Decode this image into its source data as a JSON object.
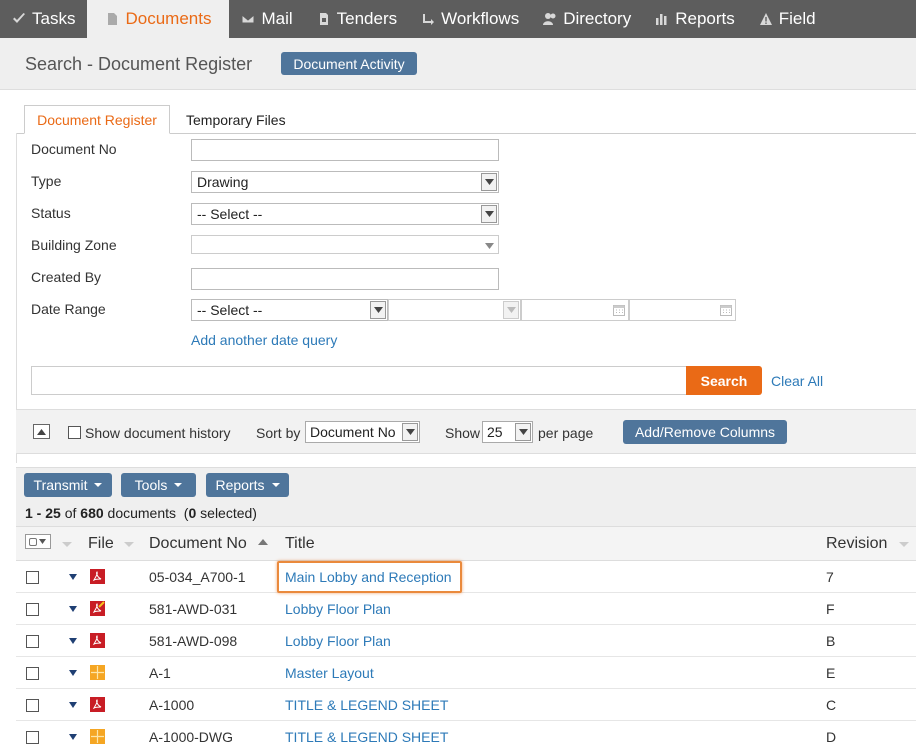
{
  "nav": [
    {
      "label": "Tasks",
      "icon": "check-icon",
      "active": false
    },
    {
      "label": "Documents",
      "icon": "document-icon",
      "active": true
    },
    {
      "label": "Mail",
      "icon": "mail-icon",
      "active": false
    },
    {
      "label": "Tenders",
      "icon": "tender-icon",
      "active": false
    },
    {
      "label": "Workflows",
      "icon": "workflow-icon",
      "active": false
    },
    {
      "label": "Directory",
      "icon": "people-icon",
      "active": false
    },
    {
      "label": "Reports",
      "icon": "bar-chart-icon",
      "active": false
    },
    {
      "label": "Field",
      "icon": "warning-icon",
      "active": false
    }
  ],
  "header": {
    "title": "Search - Document Register",
    "activity_button": "Document Activity"
  },
  "tabs": {
    "register": "Document Register",
    "temporary": "Temporary Files"
  },
  "form": {
    "document_no_label": "Document No",
    "document_no_value": "",
    "type_label": "Type",
    "type_value": "Drawing",
    "status_label": "Status",
    "status_value": "-- Select --",
    "zone_label": "Building Zone",
    "zone_value": "",
    "created_by_label": "Created By",
    "created_by_value": "",
    "date_range_label": "Date Range",
    "date_range_value": "-- Select --",
    "add_date_query": "Add another date query",
    "search_button": "Search",
    "clear_all": "Clear All"
  },
  "options": {
    "show_history": "Show document history",
    "sort_by_label": "Sort by",
    "sort_by_value": "Document No",
    "show_label": "Show",
    "show_value": "25",
    "per_page": "per page",
    "columns_button": "Add/Remove Columns"
  },
  "toolbar": {
    "transmit": "Transmit",
    "tools": "Tools",
    "reports": "Reports"
  },
  "results": {
    "range": "1 - 25",
    "of": "of",
    "total": "680",
    "documents": "documents",
    "selected_open": "(",
    "selected_count": "0",
    "selected_close": "selected)"
  },
  "columns": {
    "file": "File",
    "document_no": "Document No",
    "title": "Title",
    "revision": "Revision"
  },
  "rows": [
    {
      "file_icon": "pdf-icon",
      "document_no": "05-034_A700-1",
      "title": "Main Lobby and Reception",
      "revision": "7"
    },
    {
      "file_icon": "pdf-markup-icon",
      "document_no": "581-AWD-031",
      "title": "Lobby Floor Plan",
      "revision": "F"
    },
    {
      "file_icon": "pdf-icon",
      "document_no": "581-AWD-098",
      "title": "Lobby Floor Plan",
      "revision": "B"
    },
    {
      "file_icon": "cad-icon",
      "document_no": "A-1",
      "title": "Master Layout",
      "revision": "E"
    },
    {
      "file_icon": "pdf-icon",
      "document_no": "A-1000",
      "title": "TITLE & LEGEND SHEET",
      "revision": "C"
    },
    {
      "file_icon": "cad-icon",
      "document_no": "A-1000-DWG",
      "title": "TITLE & LEGEND SHEET",
      "revision": "D"
    }
  ],
  "colors": {
    "accent": "#ea6a16",
    "nav_bg": "#5d5d5d",
    "button_blue": "#4f759b",
    "link": "#2d7ab8"
  }
}
